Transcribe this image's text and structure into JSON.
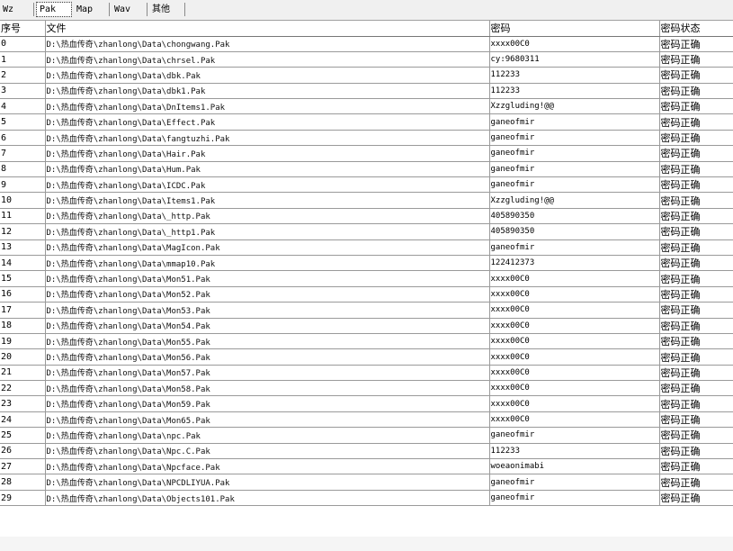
{
  "tabs": [
    {
      "label": "Wz",
      "active": false
    },
    {
      "label": "Pak",
      "active": true
    },
    {
      "label": "Map",
      "active": false
    },
    {
      "label": "Wav",
      "active": false
    },
    {
      "label": "其他",
      "active": false
    }
  ],
  "table": {
    "headers": [
      "序号",
      "文件",
      "密码",
      "密码状态"
    ],
    "rows": [
      [
        "0",
        "D:\\热血传奇\\zhanlong\\Data\\chongwang.Pak",
        "xxxx00C0",
        "密码正确"
      ],
      [
        "1",
        "D:\\热血传奇\\zhanlong\\Data\\chrsel.Pak",
        "cy:9680311",
        "密码正确"
      ],
      [
        "2",
        "D:\\热血传奇\\zhanlong\\Data\\dbk.Pak",
        "112233",
        "密码正确"
      ],
      [
        "3",
        "D:\\热血传奇\\zhanlong\\Data\\dbk1.Pak",
        "112233",
        "密码正确"
      ],
      [
        "4",
        "D:\\热血传奇\\zhanlong\\Data\\DnItems1.Pak",
        "Xzzgluding!@@",
        "密码正确"
      ],
      [
        "5",
        "D:\\热血传奇\\zhanlong\\Data\\Effect.Pak",
        "ganeofmir",
        "密码正确"
      ],
      [
        "6",
        "D:\\热血传奇\\zhanlong\\Data\\fangtuzhi.Pak",
        "ganeofmir",
        "密码正确"
      ],
      [
        "7",
        "D:\\热血传奇\\zhanlong\\Data\\Hair.Pak",
        "ganeofmir",
        "密码正确"
      ],
      [
        "8",
        "D:\\热血传奇\\zhanlong\\Data\\Hum.Pak",
        "ganeofmir",
        "密码正确"
      ],
      [
        "9",
        "D:\\热血传奇\\zhanlong\\Data\\ICDC.Pak",
        "ganeofmir",
        "密码正确"
      ],
      [
        "10",
        "D:\\热血传奇\\zhanlong\\Data\\Items1.Pak",
        "Xzzgluding!@@",
        "密码正确"
      ],
      [
        "11",
        "D:\\热血传奇\\zhanlong\\Data\\_http.Pak",
        "405890350",
        "密码正确"
      ],
      [
        "12",
        "D:\\热血传奇\\zhanlong\\Data\\_http1.Pak",
        "405890350",
        "密码正确"
      ],
      [
        "13",
        "D:\\热血传奇\\zhanlong\\Data\\MagIcon.Pak",
        "ganeofmir",
        "密码正确"
      ],
      [
        "14",
        "D:\\热血传奇\\zhanlong\\Data\\mmap10.Pak",
        "122412373",
        "密码正确"
      ],
      [
        "15",
        "D:\\热血传奇\\zhanlong\\Data\\Mon51.Pak",
        "xxxx00C0",
        "密码正确"
      ],
      [
        "16",
        "D:\\热血传奇\\zhanlong\\Data\\Mon52.Pak",
        "xxxx00C0",
        "密码正确"
      ],
      [
        "17",
        "D:\\热血传奇\\zhanlong\\Data\\Mon53.Pak",
        "xxxx00C0",
        "密码正确"
      ],
      [
        "18",
        "D:\\热血传奇\\zhanlong\\Data\\Mon54.Pak",
        "xxxx00C0",
        "密码正确"
      ],
      [
        "19",
        "D:\\热血传奇\\zhanlong\\Data\\Mon55.Pak",
        "xxxx00C0",
        "密码正确"
      ],
      [
        "20",
        "D:\\热血传奇\\zhanlong\\Data\\Mon56.Pak",
        "xxxx00C0",
        "密码正确"
      ],
      [
        "21",
        "D:\\热血传奇\\zhanlong\\Data\\Mon57.Pak",
        "xxxx00C0",
        "密码正确"
      ],
      [
        "22",
        "D:\\热血传奇\\zhanlong\\Data\\Mon58.Pak",
        "xxxx00C0",
        "密码正确"
      ],
      [
        "23",
        "D:\\热血传奇\\zhanlong\\Data\\Mon59.Pak",
        "xxxx00C0",
        "密码正确"
      ],
      [
        "24",
        "D:\\热血传奇\\zhanlong\\Data\\Mon65.Pak",
        "xxxx00C0",
        "密码正确"
      ],
      [
        "25",
        "D:\\热血传奇\\zhanlong\\Data\\npc.Pak",
        "ganeofmir",
        "密码正确"
      ],
      [
        "26",
        "D:\\热血传奇\\zhanlong\\Data\\Npc.C.Pak",
        "112233",
        "密码正确"
      ],
      [
        "27",
        "D:\\热血传奇\\zhanlong\\Data\\Npcface.Pak",
        "woeaonimabi",
        "密码正确"
      ],
      [
        "28",
        "D:\\热血传奇\\zhanlong\\Data\\NPCDLIYUA.Pak",
        "ganeofmir",
        "密码正确"
      ],
      [
        "29",
        "D:\\热血传奇\\zhanlong\\Data\\Objects101.Pak",
        "ganeofmir",
        "密码正确"
      ]
    ]
  }
}
